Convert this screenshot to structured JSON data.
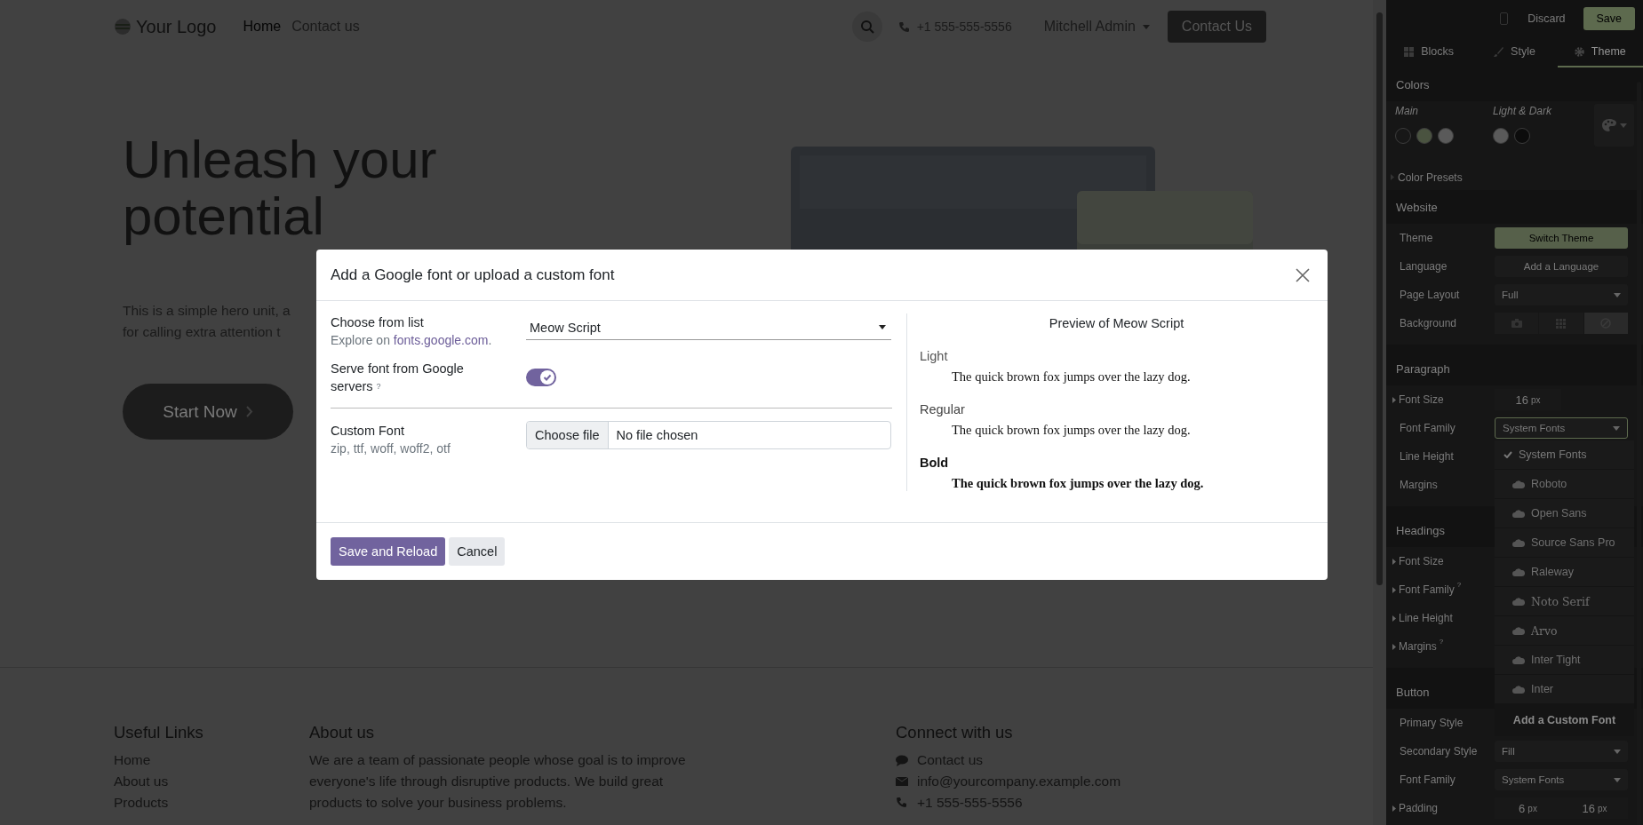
{
  "page": {
    "navbar": {
      "logo": "Your Logo",
      "links": [
        {
          "label": "Home",
          "selected": true
        },
        {
          "label": "Contact us",
          "selected": false
        }
      ],
      "phone": "+1 555-555-5556",
      "user": "Mitchell Admin",
      "cta": "Contact Us"
    },
    "hero": {
      "heading": "Unleash your potential",
      "text_lines": [
        "This is a simple hero unit, a",
        "for calling extra attention t"
      ],
      "button": "Start Now"
    },
    "footer": {
      "columns": [
        {
          "kind": "links",
          "title": "Useful Links",
          "items": [
            "Home",
            "About us",
            "Products"
          ]
        },
        {
          "kind": "text",
          "title": "About us",
          "text": "We are a team of passionate people whose goal is to improve everyone's life through disruptive products. We build great products to solve your business problems."
        },
        {
          "kind": "contacts",
          "title": "Connect with us",
          "items": [
            {
              "kind": "chat",
              "text": "Contact us"
            },
            {
              "kind": "mail",
              "text": "info@yourcompany.example.com"
            },
            {
              "kind": "phone",
              "text": "+1 555-555-5556"
            }
          ]
        }
      ]
    }
  },
  "editor": {
    "discard": "Discard",
    "save": "Save",
    "tabs": [
      {
        "kind": "blocks",
        "label": "Blocks",
        "selected": false
      },
      {
        "kind": "style",
        "label": "Style",
        "selected": false
      },
      {
        "kind": "theme",
        "label": "Theme",
        "selected": true
      }
    ],
    "colors": {
      "title": "Colors",
      "main_label": "Main",
      "light_dark_label": "Light & Dark",
      "main_colors": [
        {
          "color": "#171717"
        },
        {
          "color": "#4a5340"
        },
        {
          "color": "#5a5a5a"
        }
      ],
      "light_dark_colors": [
        {
          "color": "#5a5a5a"
        },
        {
          "color": "#0c0c0c"
        }
      ],
      "presets": "Color Presets"
    },
    "sections": [
      {
        "title": "Website",
        "rows": [
          {
            "label": "Theme",
            "control": {
              "kind": "button",
              "text": "Switch Theme",
              "primary": true
            }
          },
          {
            "label": "Language",
            "control": {
              "kind": "button",
              "text": "Add a Language",
              "primary": false
            }
          },
          {
            "label": "Page Layout",
            "control": {
              "kind": "select",
              "value": "Full",
              "open": false
            }
          },
          {
            "label": "Background",
            "control": {
              "kind": "icons",
              "options": [
                {
                  "kind": "camera",
                  "selected": false
                },
                {
                  "kind": "grid",
                  "selected": false
                },
                {
                  "kind": "none",
                  "selected": true
                }
              ]
            }
          }
        ]
      },
      {
        "title": "Paragraph",
        "rows": [
          {
            "label": "Font Size",
            "expandable": true,
            "control": {
              "kind": "number",
              "values": [
                {
                  "value": "16",
                  "unit": "px"
                }
              ]
            }
          },
          {
            "label": "Font Family",
            "control": {
              "kind": "select",
              "value": "System Fonts",
              "open": true
            }
          },
          {
            "label": "Line Height"
          },
          {
            "label": "Margins"
          }
        ]
      },
      {
        "title": "Headings",
        "rows": [
          {
            "label": "Font Size",
            "expandable": true
          },
          {
            "label": "Font Family",
            "expandable": true,
            "help": "?"
          },
          {
            "label": "Line Height",
            "expandable": true
          },
          {
            "label": "Margins",
            "expandable": true,
            "help": "?"
          }
        ]
      },
      {
        "title": "Button",
        "rows": [
          {
            "label": "Primary Style"
          },
          {
            "label": "Secondary Style",
            "control": {
              "kind": "select",
              "value": "Fill",
              "open": false
            }
          },
          {
            "label": "Font Family",
            "control": {
              "kind": "select",
              "value": "System Fonts",
              "open": false
            }
          },
          {
            "label": "Padding",
            "expandable": true,
            "control": {
              "kind": "number",
              "values": [
                {
                  "value": "6",
                  "unit": "px"
                },
                {
                  "value": "16",
                  "unit": "px"
                }
              ]
            }
          }
        ]
      }
    ],
    "font_menu": {
      "items": [
        {
          "label": "System Fonts",
          "selected": true,
          "kind": "sans"
        },
        {
          "label": "Roboto",
          "selected": false,
          "kind": "sans"
        },
        {
          "label": "Open Sans",
          "selected": false,
          "kind": "sans"
        },
        {
          "label": "Source Sans Pro",
          "selected": false,
          "kind": "sans"
        },
        {
          "label": "Raleway",
          "selected": false,
          "kind": "sans"
        },
        {
          "label": "Noto Serif",
          "selected": false,
          "kind": "serif"
        },
        {
          "label": "Arvo",
          "selected": false,
          "kind": "serif"
        },
        {
          "label": "Inter Tight",
          "selected": false,
          "kind": "sans"
        },
        {
          "label": "Inter",
          "selected": false,
          "kind": "sans"
        }
      ],
      "add": "Add a Custom Font"
    }
  },
  "dialog": {
    "title": "Add a Google font or upload a custom font",
    "choose_label": "Choose from list",
    "explore_prefix": "Explore on ",
    "explore_link": "fonts.google.com",
    "explore_suffix": ".",
    "font_value": "Meow Script",
    "serve_label": "Serve font from Google servers",
    "serve_help": "?",
    "serve_on": true,
    "custom_label": "Custom Font",
    "custom_hint": "zip, ttf, woff, woff2, otf",
    "file_button": "Choose file",
    "file_status": "No file chosen",
    "preview_title": "Preview of Meow Script",
    "samples": [
      {
        "kind": "light",
        "label": "Light",
        "text": "The quick brown fox jumps over the lazy dog."
      },
      {
        "kind": "regular",
        "label": "Regular",
        "text": "The quick brown fox jumps over the lazy dog."
      },
      {
        "kind": "bold",
        "label": "Bold",
        "text": "The quick brown fox jumps over the lazy dog."
      }
    ],
    "buttons": [
      {
        "kind": "primary",
        "label": "Save and Reload"
      },
      {
        "kind": "secondary",
        "label": "Cancel"
      }
    ]
  }
}
